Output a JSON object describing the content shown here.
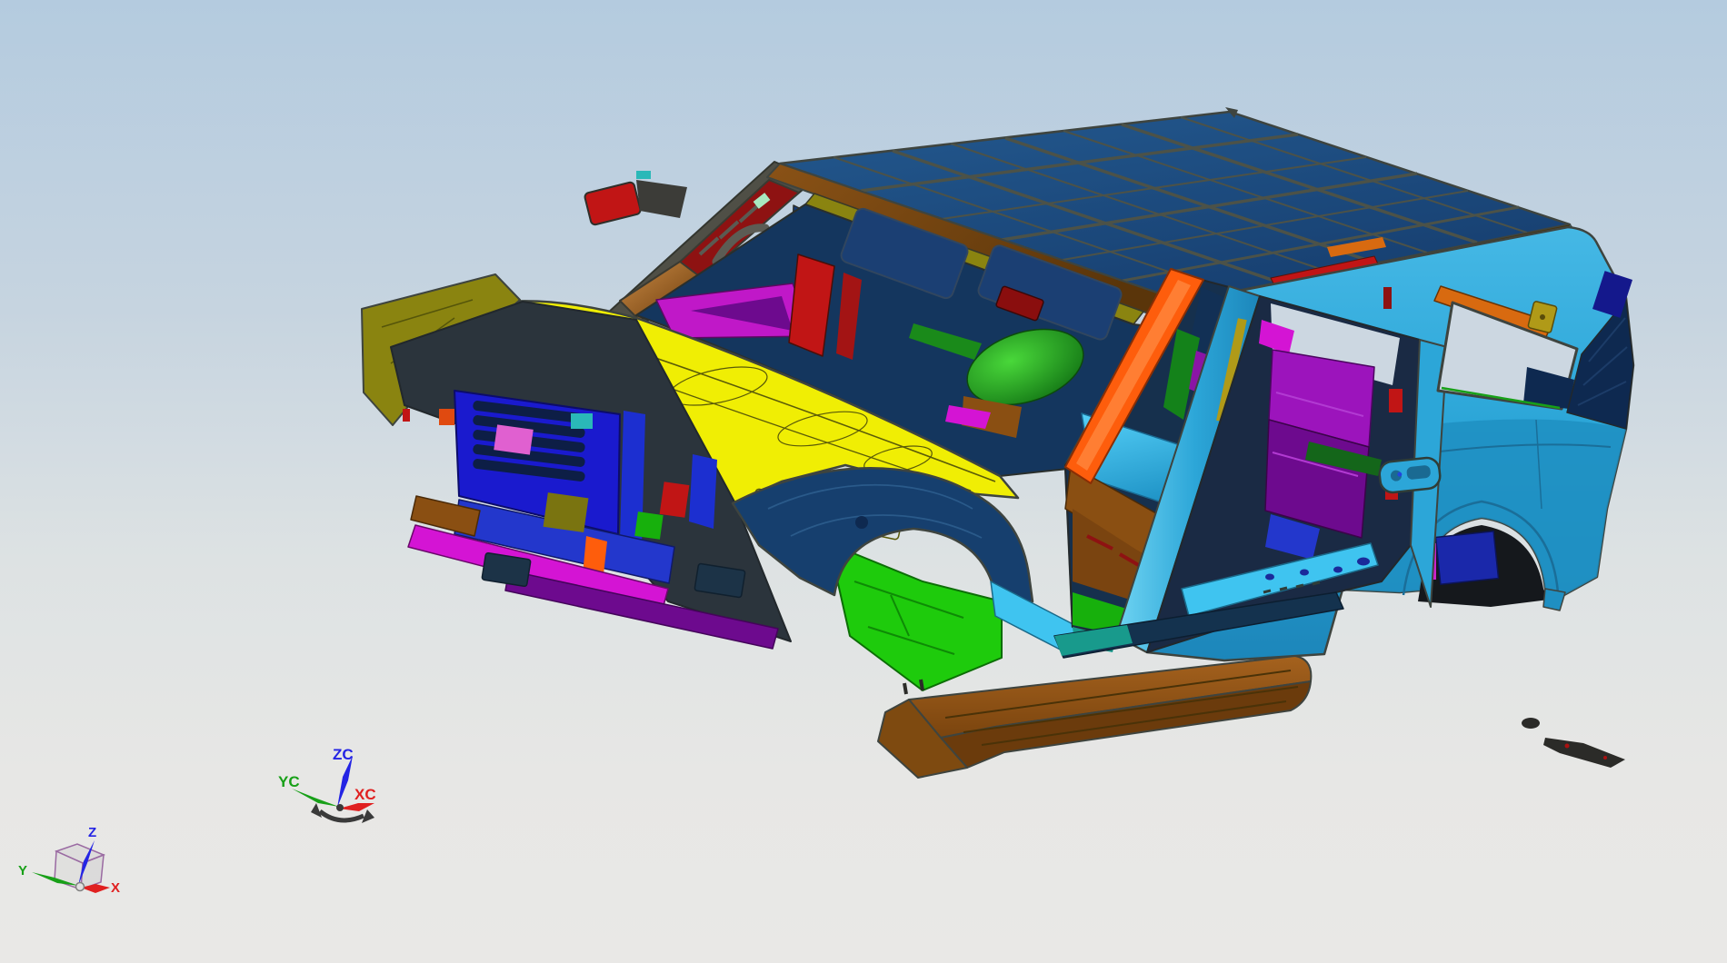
{
  "app": {
    "type": "cad-viewport",
    "description": "3D CAD shaded view of an SUV body-in-white assembly with parts displayed in distinct colors"
  },
  "viewport": {
    "background": {
      "top": "#b4cbdf",
      "upper_mid": "#c6d4e0",
      "lower_mid": "#dde2e3",
      "bottom": "#e9e8e6"
    }
  },
  "wcs_triad": {
    "axes": [
      {
        "id": "xc",
        "label": "XC",
        "color": "#e02020"
      },
      {
        "id": "yc",
        "label": "YC",
        "color": "#18a018"
      },
      {
        "id": "zc",
        "label": "ZC",
        "color": "#2424e4"
      }
    ],
    "rotator_color": "#3a3a3a"
  },
  "view_triad": {
    "axes": [
      {
        "id": "x",
        "label": "X",
        "color": "#e02020"
      },
      {
        "id": "y",
        "label": "Y",
        "color": "#18a018"
      },
      {
        "id": "z",
        "label": "Z",
        "color": "#2424e4"
      }
    ],
    "cube_color": "#9a6aa2",
    "origin_ball_color": "#e0e0e0"
  },
  "colors": {
    "outline": "#3e443f",
    "roof": "#1c4f8b",
    "roof_light": "#23598f",
    "roof_grid": "#4c5248",
    "header_brown": "#6e4210",
    "copper": "#b87333",
    "visor_olive": "#8a8410",
    "body_cyan": "#2ca6d8",
    "body_cyan_light": "#45b8e5",
    "quarter_shade": "#1f8fc2",
    "rail_cyan": "#33b0dd",
    "yellow": "#f0ee04",
    "yellow_detail": "#5a5a08",
    "navy": "#163f6e",
    "navy_dark": "#0e2950",
    "interior_dark": "#14365e",
    "door_interior": "#16304d",
    "bright_blue": "#1a1ace",
    "blue_mid": "#2337cc",
    "wheelhouse_blue": "#1a28aa",
    "green_bright": "#1ecb0c",
    "green_dark": "#14821a",
    "seat_green": "#28a32c",
    "purple": "#9c14bc",
    "purple_dark": "#6d0a8e",
    "magenta": "#d414d4",
    "orange": "#fe5d0c",
    "orange_dark": "#d86a10",
    "red": "#c11515",
    "dark_red": "#8e1212",
    "brown_board": "#95551a",
    "brown_board_dark": "#6b3b0c",
    "brown_floor": "#8a4f12",
    "teal": "#189a8c",
    "cyan_bright": "#3fc4f0",
    "olive_bracket": "#b09a18",
    "sky_through": "#ccd7e1",
    "debris": "#2b2b28",
    "mint": "#a8e8c0"
  },
  "model": {
    "name": "suv-body-in-white",
    "parts": [
      {
        "name": "roof-panel",
        "color_ref": "roof"
      },
      {
        "name": "windshield-header",
        "color_ref": "header_brown"
      },
      {
        "name": "sun-visor-rail",
        "color_ref": "visor_olive"
      },
      {
        "name": "a-pillar-inner",
        "color_ref": "dark_red"
      },
      {
        "name": "cowl-top-panel",
        "color_ref": "yellow"
      },
      {
        "name": "cowl-side-trim",
        "color_ref": "magenta"
      },
      {
        "name": "dash-panel",
        "color_ref": "interior_dark"
      },
      {
        "name": "front-seat",
        "color_ref": "seat_green"
      },
      {
        "name": "radiator-support",
        "color_ref": "bright_blue"
      },
      {
        "name": "bumper-beam",
        "color_ref": "magenta"
      },
      {
        "name": "lower-crossmember",
        "color_ref": "purple"
      },
      {
        "name": "front-fender-inner",
        "color_ref": "navy"
      },
      {
        "name": "front-floor-pan",
        "color_ref": "green_bright"
      },
      {
        "name": "hinge-pillar",
        "color_ref": "orange"
      },
      {
        "name": "b-pillar",
        "color_ref": "body_cyan"
      },
      {
        "name": "body-side-outer",
        "color_ref": "body_cyan"
      },
      {
        "name": "rear-floor-trim",
        "color_ref": "purple"
      },
      {
        "name": "tunnel-console",
        "color_ref": "brown_floor"
      },
      {
        "name": "roof-rail-strip-red",
        "color_ref": "red"
      },
      {
        "name": "quarter-window-bracket",
        "color_ref": "olive_bracket"
      },
      {
        "name": "d-pillar-inner",
        "color_ref": "navy_dark"
      },
      {
        "name": "rear-wheelhouse",
        "color_ref": "wheelhouse_blue"
      },
      {
        "name": "rocker-sill",
        "color_ref": "teal"
      },
      {
        "name": "running-board",
        "color_ref": "brown_board"
      },
      {
        "name": "loose-fragments",
        "color_ref": "debris"
      }
    ]
  }
}
